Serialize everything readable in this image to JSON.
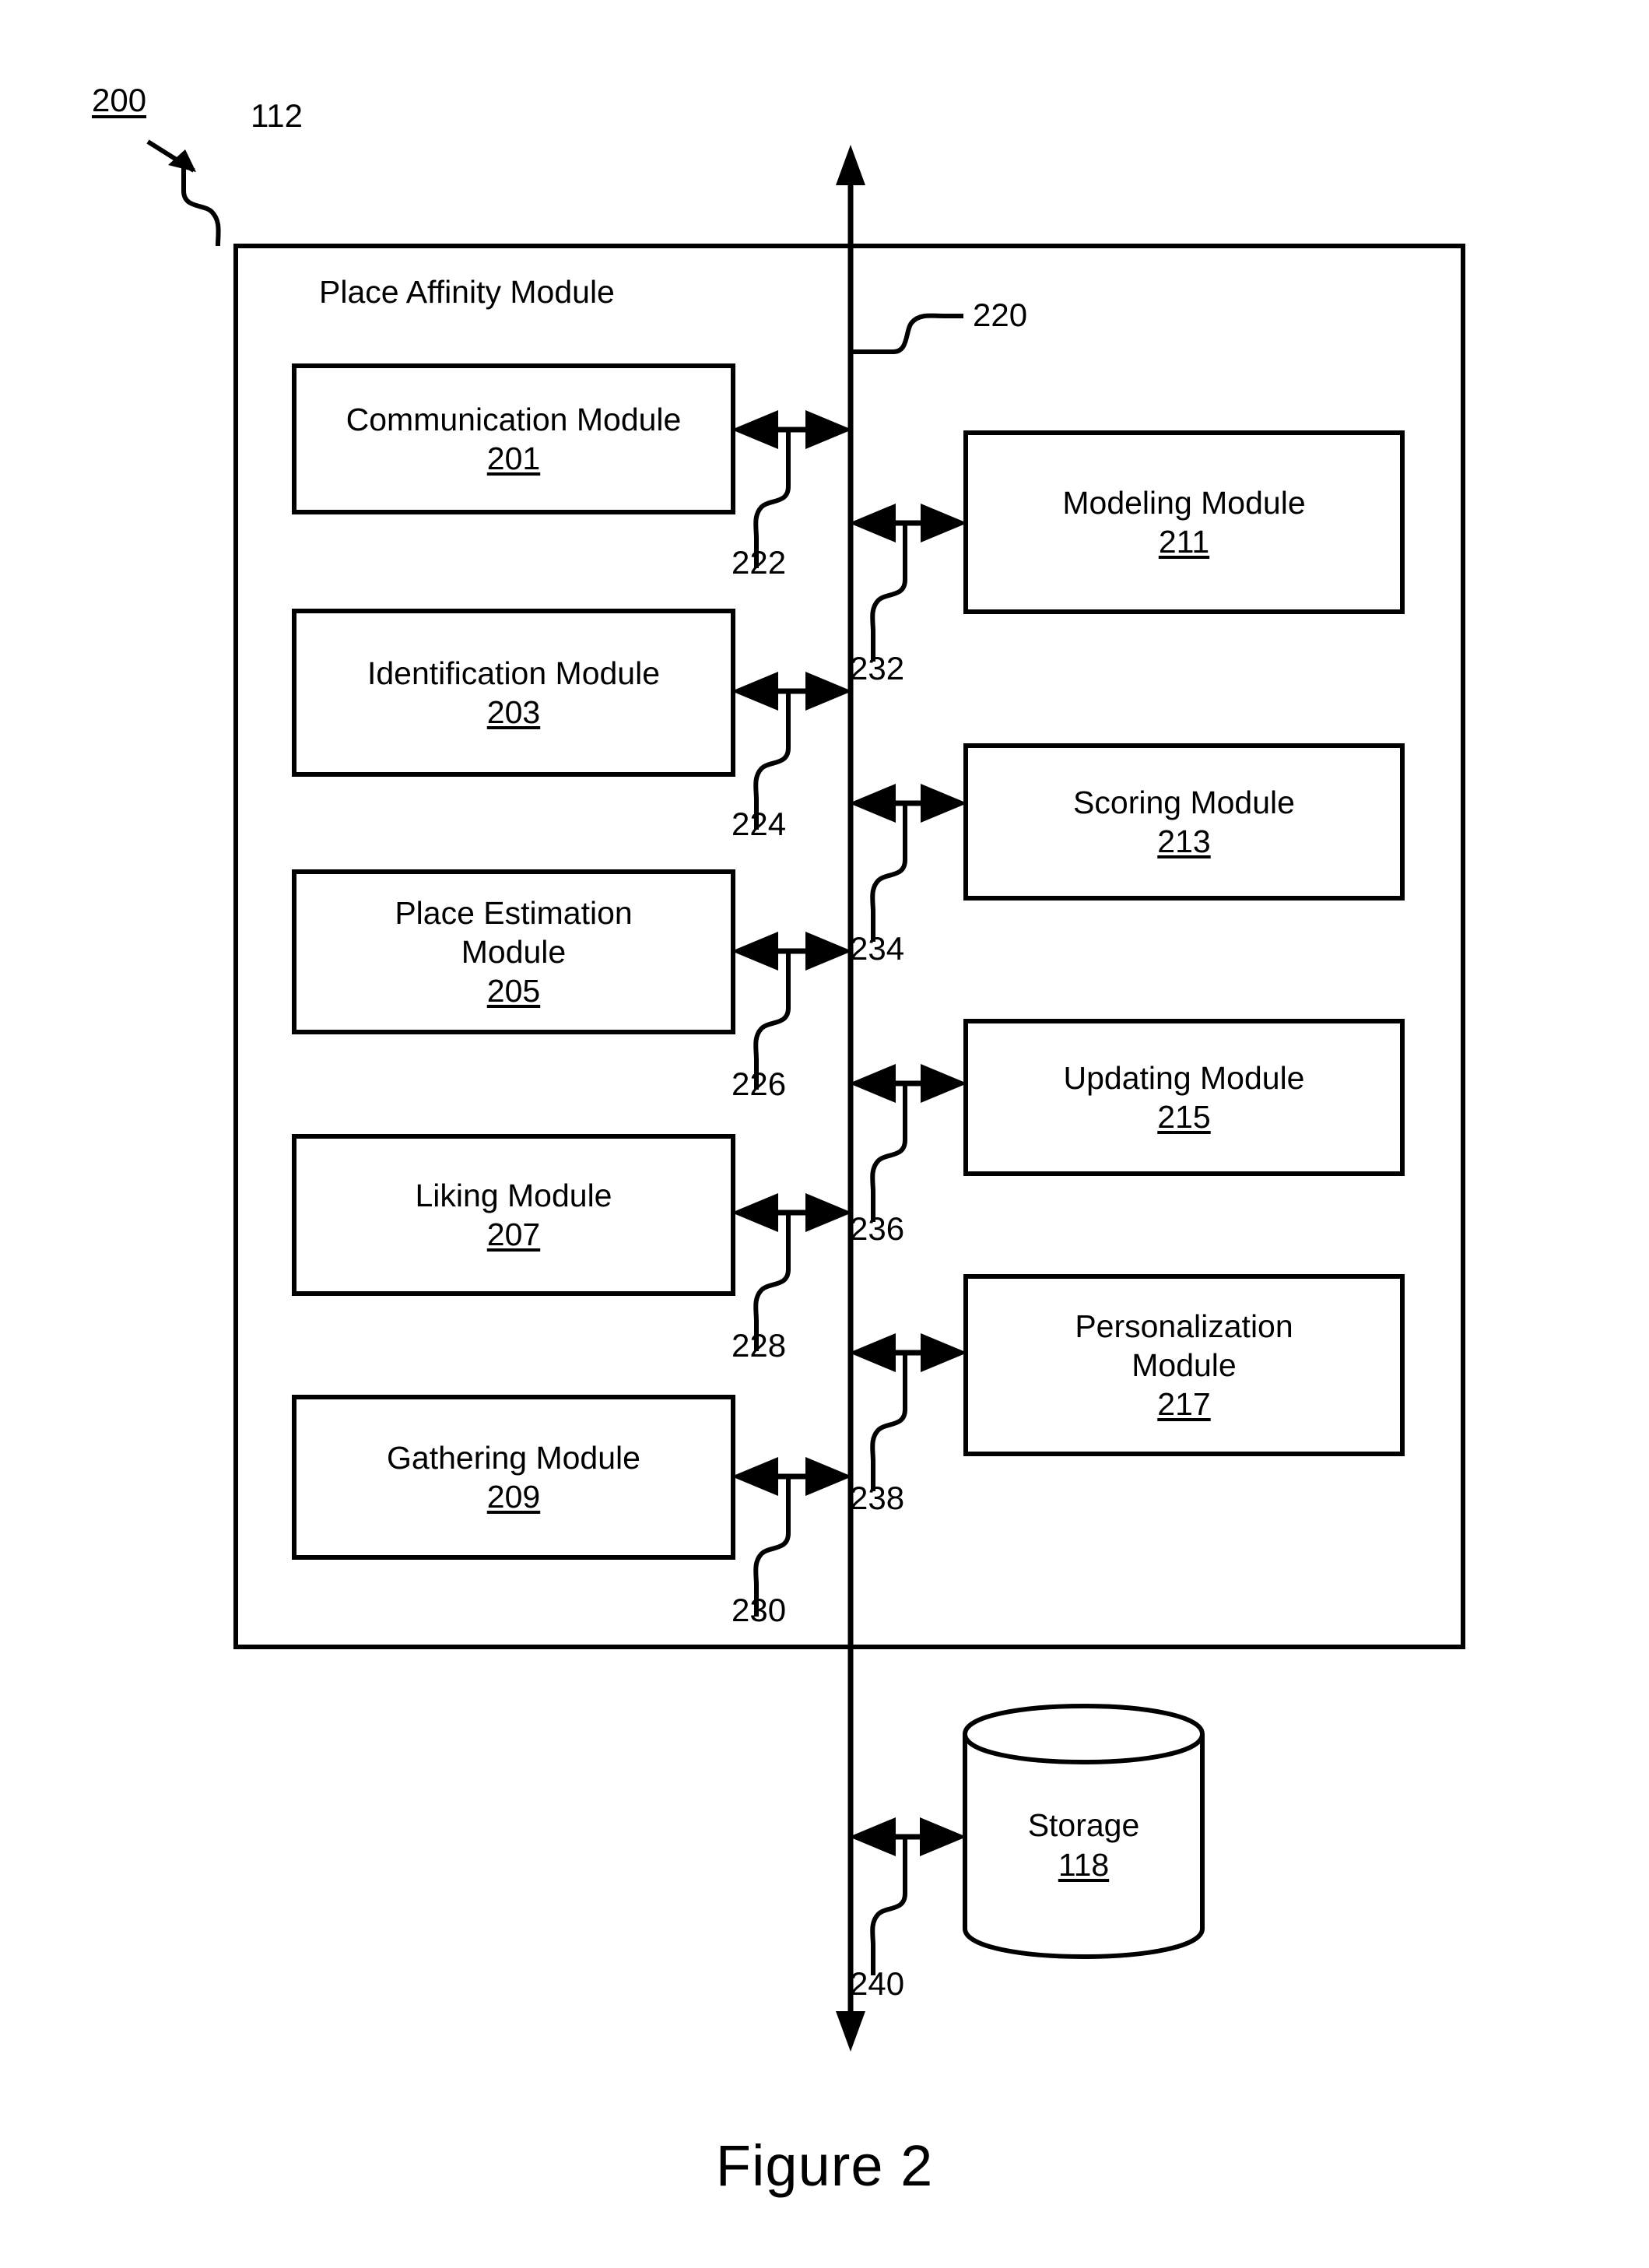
{
  "figure": {
    "caption": "Figure 2",
    "diagram_ref": "200",
    "container_ref": "112"
  },
  "container": {
    "title": "Place Affinity Module"
  },
  "bus": {
    "ref": "220",
    "name": "vertical-bus"
  },
  "left_modules": [
    {
      "name": "Communication Module",
      "num": "201",
      "link_ref": "222"
    },
    {
      "name": "Identification Module",
      "num": "203",
      "link_ref": "224"
    },
    {
      "name": "Place Estimation Module",
      "num": "205",
      "link_ref": "226"
    },
    {
      "name": "Liking Module",
      "num": "207",
      "link_ref": "228"
    },
    {
      "name": "Gathering Module",
      "num": "209",
      "link_ref": "230"
    }
  ],
  "right_modules": [
    {
      "name": "Modeling Module",
      "num": "211",
      "link_ref": "232"
    },
    {
      "name": "Scoring Module",
      "num": "213",
      "link_ref": "234"
    },
    {
      "name": "Updating Module",
      "num": "215",
      "link_ref": "236"
    },
    {
      "name": "Personalization Module",
      "num": "217",
      "link_ref": "238"
    }
  ],
  "storage": {
    "name": "Storage",
    "num": "118",
    "link_ref": "240"
  },
  "colors": {
    "ink": "#000000",
    "paper": "#ffffff"
  }
}
